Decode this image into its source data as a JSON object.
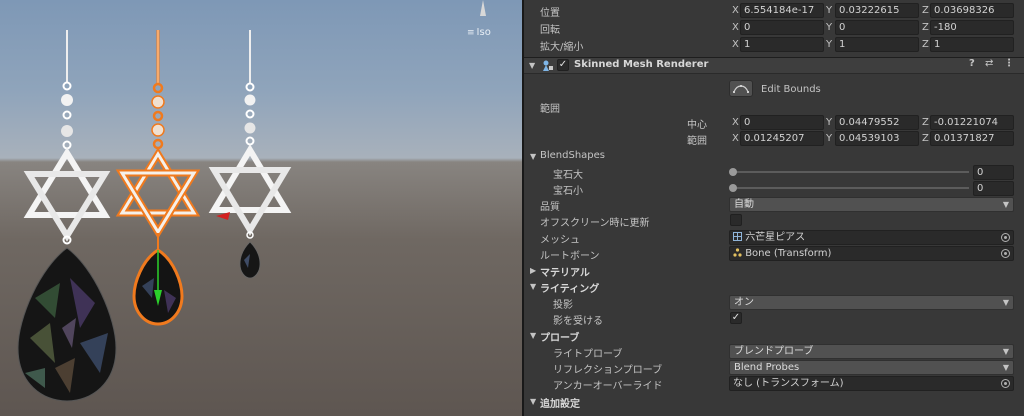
{
  "scene": {
    "view_label": "Iso",
    "gizmo_icon": "axis-gizmo-icon",
    "menu_icon": "hamburger-icon"
  },
  "transform": {
    "position": {
      "label": "位置",
      "x": "6.554184e-17",
      "y": "0.03222615",
      "z": "0.03698326"
    },
    "rotation": {
      "label": "回転",
      "x": "0",
      "y": "0",
      "z": "-180"
    },
    "scale": {
      "label": "拡大/縮小",
      "x": "1",
      "y": "1",
      "z": "1"
    }
  },
  "axes": {
    "x": "X",
    "y": "Y",
    "z": "Z"
  },
  "component": {
    "title": "Skinned Mesh Renderer",
    "enabled": true,
    "icons": [
      "help-icon",
      "preset-icon",
      "kebab-menu-icon"
    ],
    "help_glyph": "?",
    "preset_glyph": "⇄",
    "menu_glyph": "⋮"
  },
  "edit_bounds": {
    "label": "Edit Bounds"
  },
  "bounds": {
    "label": "範囲",
    "center": {
      "label": "中心",
      "x": "0",
      "y": "0.04479552",
      "z": "-0.01221074"
    },
    "extent": {
      "label": "範囲",
      "x": "0.01245207",
      "y": "0.04539103",
      "z": "0.01371827"
    }
  },
  "blendshapes": {
    "label": "BlendShapes",
    "items": [
      {
        "label": "宝石大",
        "value": "0",
        "level": 0
      },
      {
        "label": "宝石小",
        "value": "0",
        "level": 0
      }
    ]
  },
  "quality": {
    "label": "品質",
    "value": "自動"
  },
  "update_offscreen": {
    "label": "オフスクリーン時に更新",
    "checked": false
  },
  "mesh": {
    "label": "メッシュ",
    "value": "六芒星ピアス"
  },
  "root_bone": {
    "label": "ルートボーン",
    "value": "Bone (Transform)"
  },
  "sections": {
    "materials": "マテリアル",
    "lighting": "ライティング",
    "probes": "プローブ",
    "additional": "追加設定"
  },
  "lighting": {
    "cast_shadows": {
      "label": "投影",
      "value": "オン"
    },
    "receive_shadows": {
      "label": "影を受ける",
      "checked": true
    }
  },
  "probes": {
    "light_probes": {
      "label": "ライトプローブ",
      "value": "ブレンドプローブ"
    },
    "reflection_probes": {
      "label": "リフレクションプローブ",
      "value": "Blend Probes"
    },
    "anchor_override": {
      "label": "アンカーオーバーライド",
      "value": "なし (トランスフォーム)"
    }
  },
  "checkmark": "✓",
  "fold_open": "▼",
  "fold_closed": "▶",
  "dropdown_arrow": "▼",
  "colors": {
    "inspector_bg": "#383838",
    "field_bg": "#2a2a2a",
    "selection_outline": "#f07a1e",
    "sky": "#8fa4bb",
    "ground": "#6f6862"
  }
}
